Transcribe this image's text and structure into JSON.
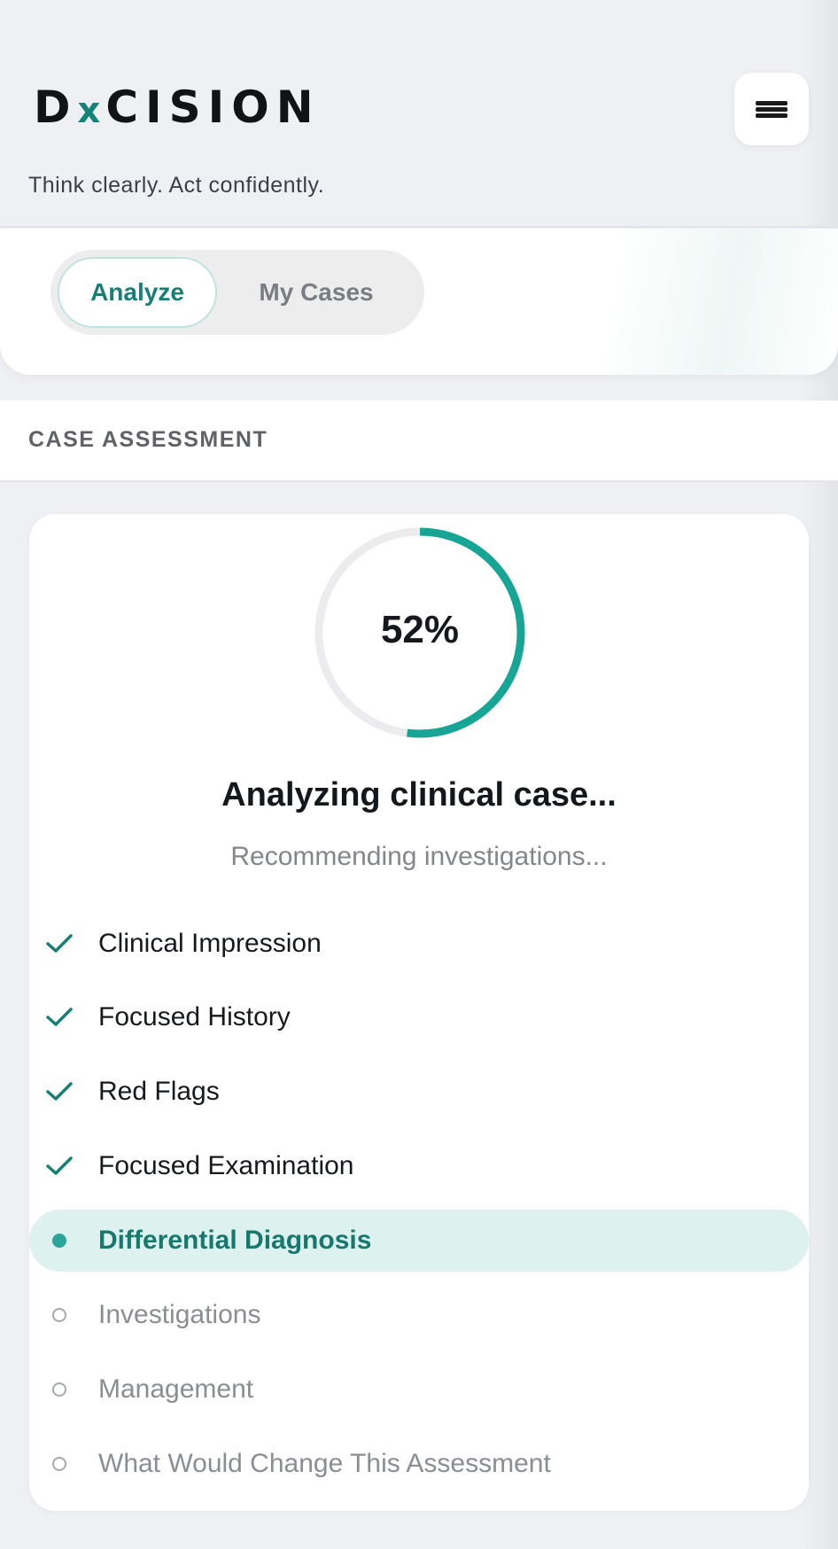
{
  "header": {
    "logo_part1": "D",
    "logo_x": "x",
    "logo_part2": "CISION",
    "tagline": "Think clearly. Act confidently.",
    "menu_icon": "hamburger-menu-icon"
  },
  "tabs": [
    {
      "label": "Analyze",
      "active": true
    },
    {
      "label": "My Cases",
      "active": false
    }
  ],
  "section": {
    "title": "CASE ASSESSMENT"
  },
  "progress": {
    "percent": 52,
    "label": "52%",
    "title": "Analyzing clinical case...",
    "subtitle": "Recommending investigations..."
  },
  "steps": [
    {
      "label": "Clinical Impression",
      "status": "done"
    },
    {
      "label": "Focused History",
      "status": "done"
    },
    {
      "label": "Red Flags",
      "status": "done"
    },
    {
      "label": "Focused Examination",
      "status": "done"
    },
    {
      "label": "Differential Diagnosis",
      "status": "current"
    },
    {
      "label": "Investigations",
      "status": "pending"
    },
    {
      "label": "Management",
      "status": "pending"
    },
    {
      "label": "What Would Change This Assessment",
      "status": "pending"
    }
  ],
  "colors": {
    "accent": "#17a595",
    "accent_dark": "#177f74",
    "track": "#ececee",
    "background": "#eff0f4"
  }
}
